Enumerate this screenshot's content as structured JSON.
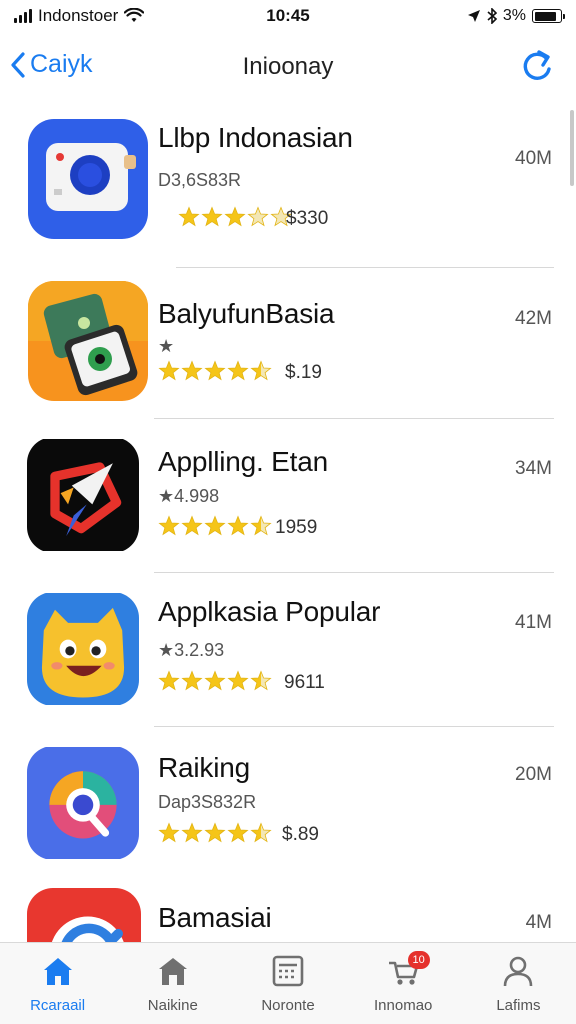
{
  "status_bar": {
    "carrier": "Indonstoer",
    "time": "10:45",
    "battery": "3%",
    "battery_level": 0.85
  },
  "nav": {
    "back_label": "Caiyk",
    "title": "Inioonay"
  },
  "apps": [
    {
      "name": "Llbp Indonasian",
      "sub": "D3,6S83R",
      "stars": 3,
      "price": "$330",
      "size": "40M",
      "icon": "camera-app-icon"
    },
    {
      "name": "BalyufunBasia",
      "sub": "★",
      "stars": 4.5,
      "price": "$.19",
      "size": "42M",
      "icon": "tablet-app-icon"
    },
    {
      "name": "Applling. Etan",
      "sub": "★4.998",
      "stars": 4.5,
      "price": "1959",
      "size": "34M",
      "icon": "arrow-app-icon"
    },
    {
      "name": "Applkasia Popular",
      "sub": "★3.2.93",
      "stars": 4.5,
      "price": "9611",
      "size": "41M",
      "icon": "mascot-app-icon"
    },
    {
      "name": "Raiking",
      "sub": "Dap3S832R",
      "stars": 4.5,
      "price": "$.89",
      "size": "20M",
      "icon": "globe-app-icon"
    },
    {
      "name": "Bamasiai",
      "sub": "",
      "stars": 0,
      "price": "",
      "size": "4M",
      "icon": "red-app-icon"
    }
  ],
  "tabs": [
    {
      "label": "Rcaraail",
      "icon": "home-icon",
      "active": true
    },
    {
      "label": "Naikine",
      "icon": "store-icon",
      "active": false
    },
    {
      "label": "Noronte",
      "icon": "grid-list-icon",
      "active": false
    },
    {
      "label": "Innomao",
      "icon": "cart-icon",
      "active": false,
      "badge": "10"
    },
    {
      "label": "Lafims",
      "icon": "person-icon",
      "active": false
    }
  ],
  "colors": {
    "accent": "#1a7cf0",
    "star": "#f5c518",
    "badge": "#e5312c"
  }
}
